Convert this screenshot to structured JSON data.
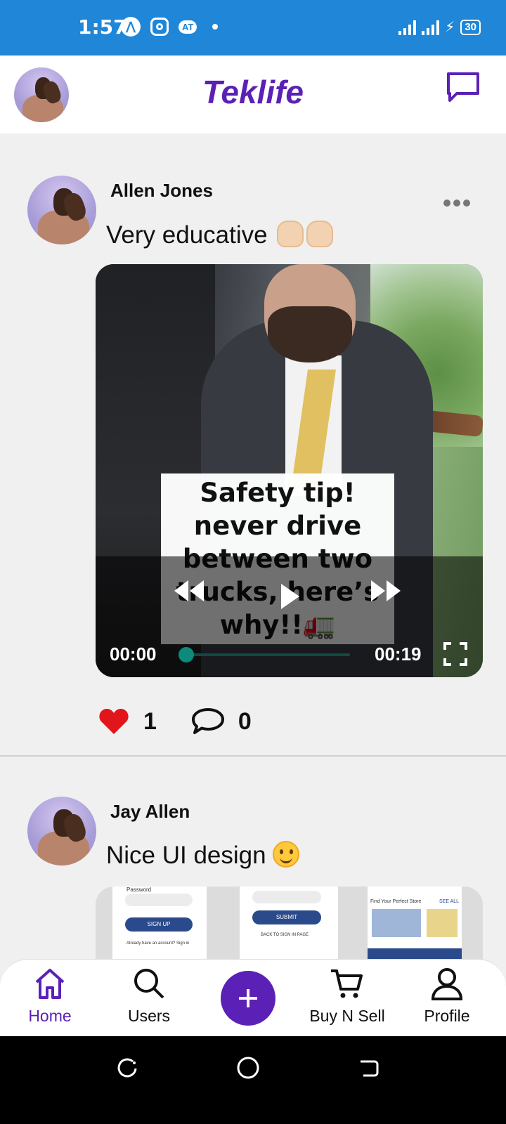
{
  "status_bar": {
    "time": "1:57",
    "notif_badge": "AT",
    "battery": "30"
  },
  "header": {
    "title": "Teklife",
    "messages_icon": "chat-bubble-icon"
  },
  "posts": [
    {
      "author": "Allen Jones",
      "text": "Very educative",
      "emoji": "👍👍",
      "video": {
        "caption": "Safety tip! never drive between two trucks, here’s why!!🚛",
        "current_time": "00:00",
        "total_time": "00:19",
        "progress": 0
      },
      "likes": "1",
      "comments": "0"
    },
    {
      "author": "Jay Allen",
      "text": "Nice UI design",
      "emoji": "😊",
      "preview": {
        "screen1_label": "Password",
        "screen1_button": "SIGN UP",
        "screen1_link": "Already have an account? Sign in",
        "screen2_button": "SUBMIT",
        "screen2_link": "BACK TO SIGN IN PAGE",
        "screen3_title": "Find Your Perfect Store",
        "screen3_link": "SEE ALL"
      }
    }
  ],
  "bottom_nav": {
    "items": [
      {
        "label": "Home",
        "icon": "home-icon",
        "active": true
      },
      {
        "label": "Users",
        "icon": "search-icon"
      },
      {
        "label": "Buy N Sell",
        "icon": "cart-icon"
      },
      {
        "label": "Profile",
        "icon": "person-icon"
      }
    ],
    "fab_icon": "plus-icon"
  },
  "colors": {
    "accent": "#5b21b6",
    "status_bar": "#1f86d8",
    "like": "#e0161a",
    "progress": "#0c8a7c"
  }
}
